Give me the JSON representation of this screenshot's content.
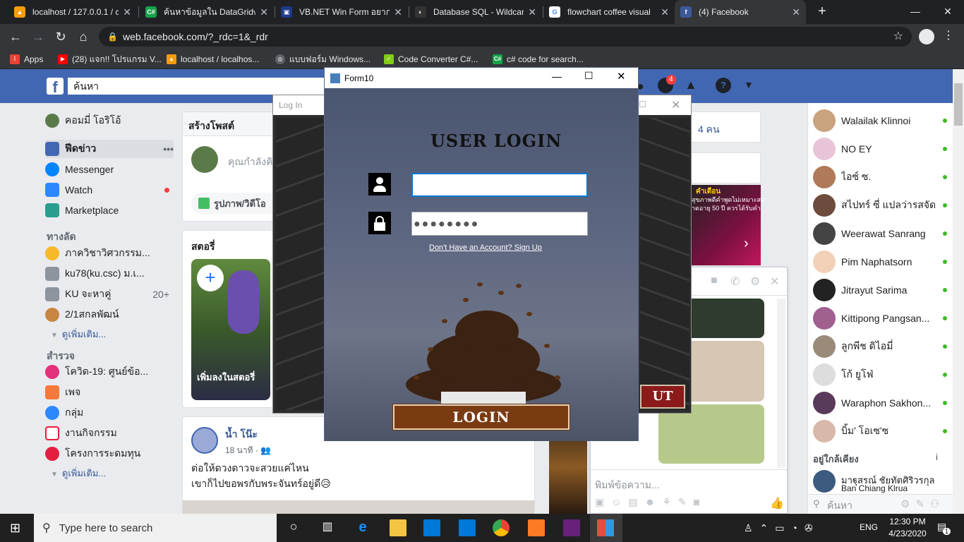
{
  "browser": {
    "tabs": [
      {
        "label": "localhost / 127.0.0.1 / c",
        "icon": "phpmyadmin-icon"
      },
      {
        "label": "ค้นหาข้อมูลใน DataGridvi",
        "icon": "csharp-icon"
      },
      {
        "label": "VB.NET Win Form อยากทำ",
        "icon": "vbnet-icon"
      },
      {
        "label": "Database SQL - Wildcar",
        "icon": "database-icon"
      },
      {
        "label": "flowchart coffee visual",
        "icon": "google-icon"
      },
      {
        "label": "(4) Facebook",
        "icon": "facebook-icon"
      }
    ],
    "url": "web.facebook.com/?_rdc=1&_rdr",
    "bookmarks": [
      {
        "label": "Apps"
      },
      {
        "label": "(28) แจก!! โปรแกรม V..."
      },
      {
        "label": "localhost / localhos..."
      },
      {
        "label": "แบบฟอร์ม Windows..."
      },
      {
        "label": "Code Converter C#..."
      },
      {
        "label": "c# code for search..."
      }
    ]
  },
  "facebook": {
    "search_placeholder": "ค้นหา",
    "notifications_badge": "4",
    "left_nav": {
      "profile": "คอมมี่ โอริโอ้",
      "items": [
        "ฟีดข่าว",
        "Messenger",
        "Watch",
        "Marketplace"
      ],
      "shortcuts_header": "ทางลัด",
      "shortcuts": [
        "ภาควิชาวิศวกรรม...",
        "ku78(ku.csc) ม.เ...",
        "KU จะหาคู่",
        "2/1สกลพัฒน์"
      ],
      "shortcut_count": "20+",
      "see_more_1": "ดูเพิ่มเติม...",
      "explore_header": "สำรวจ",
      "explore": [
        "โควิด-19: ศูนย์ข้อ...",
        "เพจ",
        "กลุ่ม",
        "งานกิจกรรม",
        "โครงการระดมทุน"
      ],
      "see_more_2": "ดูเพิ่มเติม..."
    },
    "composer": {
      "title": "สร้างโพสต์",
      "placeholder": "คุณกำลังคิ",
      "photo_label": "รูปภาพ/วิดีโอ"
    },
    "stories": {
      "title": "สตอรี่",
      "add_label": "เพิ่มลงในสตอรี่"
    },
    "post": {
      "author": "น้ำ โน๊ะ",
      "time": "18 นาที",
      "line1": "ต่อให้ดวงดาวจะสวยแค่ไหน",
      "line2": "เขาก็ไปขอพรกับพระจันทร์อยู่ดี😥"
    },
    "right_partial": "4 คน",
    "ad_text_1": "คำเตือน",
    "ad_text_2": "สุขภาพดีคำพูดไม่เหมาะสม",
    "ad_text_3": "าดอายุ 50 ปี ควรได้รับคำแนะน",
    "chat_input_placeholder": "พิมพ์ข้อความ...",
    "contacts": [
      "Walailak Klinnoi",
      "NO EY",
      "ไอซ์ ซ.",
      "สไปทร์ ซี่ แปลว่ารสจัด",
      "Weerawat Sanrang",
      "Pim Naphatsorn",
      "Jitrayut Sarima",
      "Kittipong Pangsan...",
      "ลูกพีช ดิไอมี่",
      "โก้ ยูโฟ่",
      "Waraphon Sakhon...",
      "บิ้ม' โอเซ'ซ"
    ],
    "nearby_header": "อยู่ใกล้เคียง",
    "nearby": {
      "name": "มาฐุสรณ์ ชัยทัตศิริวรกุล",
      "sub": "Ban Chiang Klrua"
    },
    "chat_search": "ค้นหา"
  },
  "login_window": {
    "title": "Log In",
    "logout_partial": "UT"
  },
  "form10": {
    "title": "Form10",
    "heading": "USER LOGIN",
    "username_value": "",
    "password_mask": "●●●●●●●●",
    "signup_link": "Don't Have an Account? Sign Up",
    "login_button": "LOGIN"
  },
  "taskbar": {
    "search_placeholder": "Type here to search",
    "lang": "ENG",
    "time": "12:30 PM",
    "date": "4/23/2020",
    "notification_count": "1"
  }
}
